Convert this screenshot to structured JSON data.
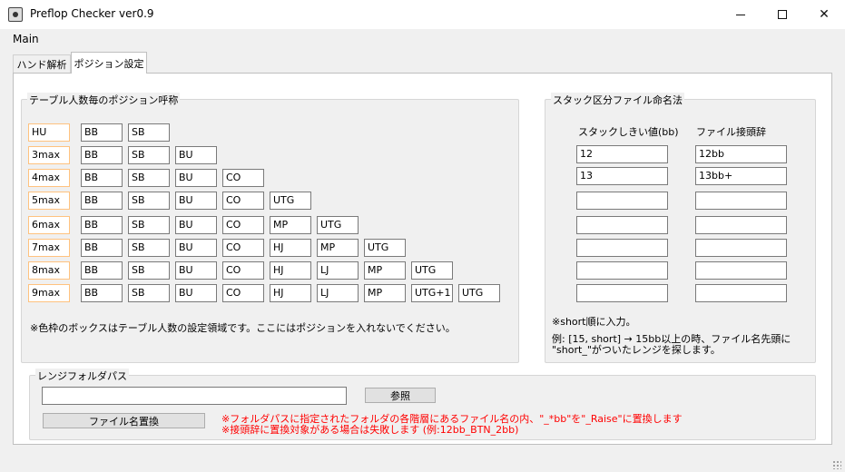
{
  "window": {
    "title": "Preflop Checker ver0.9"
  },
  "menu": {
    "main": "Main"
  },
  "tabs": [
    {
      "label": "ハンド解析"
    },
    {
      "label": "ポジション設定"
    }
  ],
  "position_group": {
    "title": "テーブル人数毎のポジション呼称",
    "rows": [
      {
        "count": "HU",
        "positions": [
          "BB",
          "SB"
        ]
      },
      {
        "count": "3max",
        "positions": [
          "BB",
          "SB",
          "BU"
        ]
      },
      {
        "count": "4max",
        "positions": [
          "BB",
          "SB",
          "BU",
          "CO"
        ]
      },
      {
        "count": "5max",
        "positions": [
          "BB",
          "SB",
          "BU",
          "CO",
          "UTG"
        ]
      },
      {
        "count": "6max",
        "positions": [
          "BB",
          "SB",
          "BU",
          "CO",
          "MP",
          "UTG"
        ]
      },
      {
        "count": "7max",
        "positions": [
          "BB",
          "SB",
          "BU",
          "CO",
          "HJ",
          "MP",
          "UTG"
        ]
      },
      {
        "count": "8max",
        "positions": [
          "BB",
          "SB",
          "BU",
          "CO",
          "HJ",
          "LJ",
          "MP",
          "UTG"
        ]
      },
      {
        "count": "9max",
        "positions": [
          "BB",
          "SB",
          "BU",
          "CO",
          "HJ",
          "LJ",
          "MP",
          "UTG+1",
          "UTG"
        ]
      }
    ],
    "note": "※色枠のボックスはテーブル人数の設定領域です。ここにはポジションを入れないでください。"
  },
  "stack_group": {
    "title": "スタック区分ファイル命名法",
    "col_threshold": "スタックしきい値(bb)",
    "col_prefix": "ファイル接頭辞",
    "rows": [
      {
        "threshold": "12",
        "prefix": "12bb"
      },
      {
        "threshold": "13",
        "prefix": "13bb+"
      },
      {
        "threshold": "",
        "prefix": ""
      },
      {
        "threshold": "",
        "prefix": ""
      },
      {
        "threshold": "",
        "prefix": ""
      },
      {
        "threshold": "",
        "prefix": ""
      },
      {
        "threshold": "",
        "prefix": ""
      }
    ],
    "note1": "※short順に入力。",
    "note2_line1": "例: [15, short]  →   15bb以上の時、ファイル名先頭に",
    "note2_line2": "\"short_\"がついたレンジを探します。"
  },
  "range_group": {
    "title": "レンジフォルダパス",
    "path_value": "",
    "browse_label": "参照",
    "rename_label": "ファイル名置換",
    "warning1": "※フォルダパスに指定されたフォルダの各階層にあるファイル名の内、\"_*bb\"を\"_Raise\"に置換します",
    "warning2": "※接頭辞に置換対象がある場合は失敗します (例:12bb_BTN_2bb)"
  }
}
